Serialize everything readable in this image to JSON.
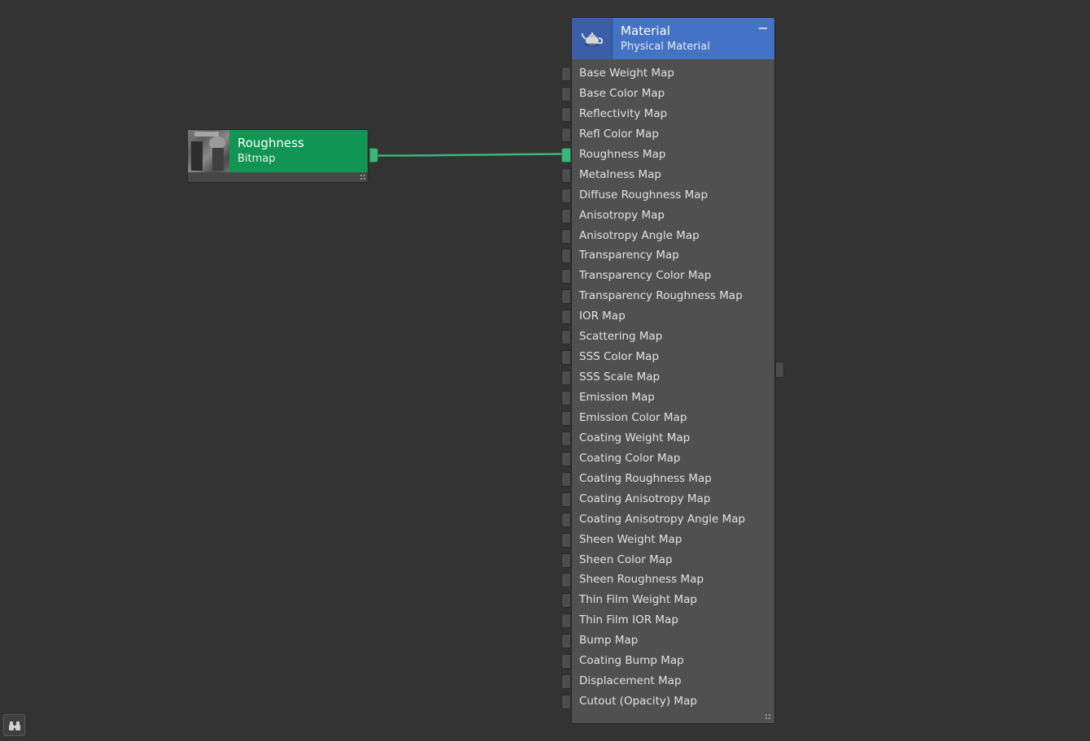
{
  "bitmap_node": {
    "title": "Roughness",
    "subtitle": "Bitmap",
    "header_color": "#119555",
    "thumbnail": "bitmap-thumbnail"
  },
  "material_node": {
    "title": "Material",
    "subtitle": "Physical Material",
    "header_color": "#4472c4",
    "icon": "teapot-icon",
    "collapse_icon": "minus-icon",
    "collapse_label": "−",
    "slots": [
      {
        "label": "Base Weight Map",
        "connected": false
      },
      {
        "label": "Base Color Map",
        "connected": false
      },
      {
        "label": "Reflectivity Map",
        "connected": false
      },
      {
        "label": "Refl Color Map",
        "connected": false
      },
      {
        "label": "Roughness Map",
        "connected": true
      },
      {
        "label": "Metalness Map",
        "connected": false
      },
      {
        "label": "Diffuse Roughness Map",
        "connected": false
      },
      {
        "label": "Anisotropy Map",
        "connected": false
      },
      {
        "label": "Anisotropy Angle Map",
        "connected": false
      },
      {
        "label": "Transparency Map",
        "connected": false
      },
      {
        "label": "Transparency Color Map",
        "connected": false
      },
      {
        "label": "Transparency Roughness Map",
        "connected": false
      },
      {
        "label": "IOR Map",
        "connected": false
      },
      {
        "label": "Scattering Map",
        "connected": false
      },
      {
        "label": "SSS Color Map",
        "connected": false
      },
      {
        "label": "SSS Scale Map",
        "connected": false
      },
      {
        "label": "Emission Map",
        "connected": false
      },
      {
        "label": "Emission Color Map",
        "connected": false
      },
      {
        "label": "Coating Weight Map",
        "connected": false
      },
      {
        "label": "Coating Color Map",
        "connected": false
      },
      {
        "label": "Coating Roughness Map",
        "connected": false
      },
      {
        "label": "Coating Anisotropy Map",
        "connected": false
      },
      {
        "label": "Coating Anisotropy Angle Map",
        "connected": false
      },
      {
        "label": "Sheen Weight Map",
        "connected": false
      },
      {
        "label": "Sheen Color Map",
        "connected": false
      },
      {
        "label": "Sheen Roughness Map",
        "connected": false
      },
      {
        "label": "Thin Film Weight Map",
        "connected": false
      },
      {
        "label": "Thin Film IOR Map",
        "connected": false
      },
      {
        "label": "Bump Map",
        "connected": false
      },
      {
        "label": "Coating Bump Map",
        "connected": false
      },
      {
        "label": "Displacement Map",
        "connected": false
      },
      {
        "label": "Cutout (Opacity) Map",
        "connected": false
      }
    ]
  },
  "wire": {
    "from": "Roughness",
    "to": "Roughness Map",
    "color": "#3cb57a"
  },
  "navigator": {
    "icon": "binoculars-icon"
  },
  "colors": {
    "canvas": "#333333",
    "node_body": "#505050",
    "socket_connected": "#3cb57a"
  }
}
